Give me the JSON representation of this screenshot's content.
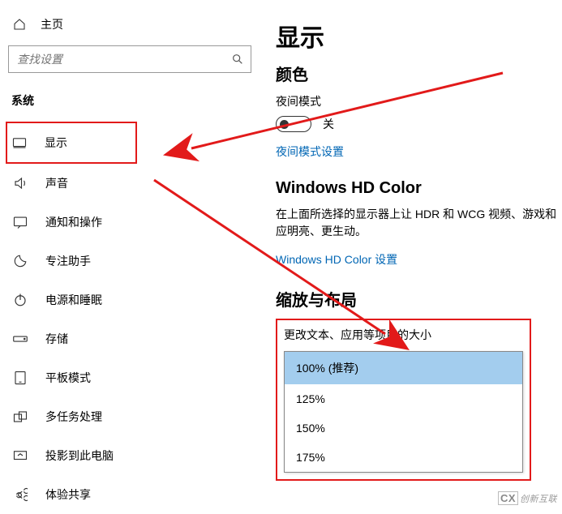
{
  "sidebar": {
    "home": "主页",
    "search_placeholder": "查找设置",
    "section": "系统",
    "items": [
      {
        "label": "显示"
      },
      {
        "label": "声音"
      },
      {
        "label": "通知和操作"
      },
      {
        "label": "专注助手"
      },
      {
        "label": "电源和睡眠"
      },
      {
        "label": "存储"
      },
      {
        "label": "平板模式"
      },
      {
        "label": "多任务处理"
      },
      {
        "label": "投影到此电脑"
      },
      {
        "label": "体验共享"
      }
    ]
  },
  "main": {
    "title": "显示",
    "color_heading": "颜色",
    "night_mode_label": "夜间模式",
    "night_mode_state": "关",
    "night_mode_link": "夜间模式设置",
    "hd_heading": "Windows HD Color",
    "hd_desc": "在上面所选择的显示器上让 HDR 和 WCG 视频、游戏和应明亮、更生动。",
    "hd_link": "Windows HD Color 设置",
    "scale_heading": "缩放与布局",
    "scale_label": "更改文本、应用等项目的大小",
    "scale_options": [
      "100% (推荐)",
      "125%",
      "150%",
      "175%"
    ]
  },
  "watermark": "创新互联"
}
